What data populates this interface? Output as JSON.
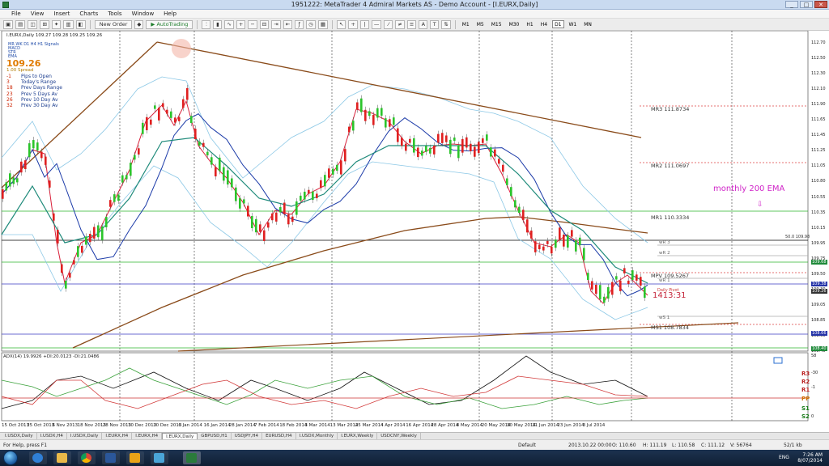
{
  "window": {
    "title": "1951222: MetaTrader 4 Admiral Markets AS - Demo Account - [I.EURX,Daily]"
  },
  "menu": [
    "File",
    "View",
    "Insert",
    "Charts",
    "Tools",
    "Window",
    "Help"
  ],
  "toolbar": {
    "new_order": "New Order",
    "autotrading": "AutoTrading",
    "timeframes": [
      "M1",
      "M5",
      "M15",
      "M30",
      "H1",
      "H4",
      "D1",
      "W1",
      "MN"
    ],
    "active_timeframe": "D1"
  },
  "chart": {
    "header": "I.EURX,Daily  109.27 109.28 109.25 109.26",
    "indicator_list": [
      "MR  WK  D1  H4  H1  Signals",
      "MACD",
      "STR",
      "EMA"
    ],
    "price": "109.26",
    "spread": "1.00 Spread",
    "stats": [
      {
        "n": "-1",
        "label": "Pips to Open"
      },
      {
        "n": "3",
        "label": "Today's Range"
      },
      {
        "n": "18",
        "label": "Prev Days Range"
      },
      {
        "n": "23",
        "label": "Prev 5 Days Av"
      },
      {
        "n": "26",
        "label": "Prev 10 Day Av"
      },
      {
        "n": "32",
        "label": "Prev 30 Day Av"
      }
    ],
    "levels": {
      "mr3": "MR3  111.8734",
      "mr2": "MR2  111.0697",
      "mr1": "MR1  110.3334",
      "mpv": "MPV  109.5267",
      "ms1": "MS1  108.7834",
      "wr3": "wR 3",
      "wr2": "wR 2",
      "wr1": "wR 1",
      "ws1": "wS 1",
      "fifty": "50.0  109.98",
      "daily_pivot": "Daily Pivot"
    },
    "monthly_ema_label": "monthly 200 EMA",
    "arrow": "⇩",
    "timer": "1413:31",
    "price_axis": [
      "112.70",
      "112.50",
      "112.30",
      "112.10",
      "111.90",
      "111.65",
      "111.45",
      "111.25",
      "111.05",
      "110.80",
      "110.55",
      "110.35",
      "110.15",
      "109.95",
      "109.75",
      "109.50",
      "109.30",
      "109.05",
      "108.85",
      "108.65",
      "108.45"
    ],
    "price_tags": [
      "109.68",
      "109.38",
      "109.26",
      "108.66",
      "108.40"
    ],
    "adx_label": "ADX(14) 19.9926  +DI:20.0123  -DI:21.0486",
    "adx_axis": [
      "58",
      "-30",
      "-1",
      "0"
    ],
    "r_labels": {
      "r3": "R3",
      "r2": "R2",
      "r1": "R1",
      "pp": "PP",
      "s1": "S1",
      "s2": "S2"
    },
    "x_axis": [
      "15 Oct 2013",
      "25 Oct 2013",
      "6 Nov 2013",
      "18 Nov 2013",
      "28 Nov 2013",
      "10 Dec 2013",
      "20 Dec 2013",
      "6 Jan 2014",
      "16 Jan 2014",
      "28 Jan 2014",
      "7 Feb 2014",
      "18 Feb 2014",
      "3 Mar 2014",
      "13 Mar 2014",
      "25 Mar 2014",
      "4 Apr 2014",
      "16 Apr 2014",
      "28 Apr 2014",
      "8 May 2014",
      "20 May 2014",
      "30 May 2014",
      "11 Jun 2014",
      "23 Jun 2014",
      "3 Jul 2014"
    ]
  },
  "tabs": [
    "I.USDX,Daily",
    "I.USDX,H4",
    "I.USDX,Daily",
    "I.EURX,H4",
    "I.EURX,H4",
    "I.EURX,Daily",
    "GBPUSD,H1",
    "USDJPY,H4",
    "EURUSD,H4",
    "I.USDX,Monthly",
    "I.EURX,Weekly",
    "USDCNY,Weekly"
  ],
  "active_tab": 5,
  "status": {
    "help": "For Help, press F1",
    "profile": "Default",
    "time": "2013.10.22 00:00",
    "open": "O: 110.60",
    "high": "H: 111.19",
    "low": "L: 110.58",
    "close": "C: 111.12",
    "volume": "V: 56764",
    "traffic": "52/1 kb"
  },
  "taskbar": {
    "lang": "ENG",
    "time": "7:26 AM",
    "date": "8/07/2014"
  }
}
